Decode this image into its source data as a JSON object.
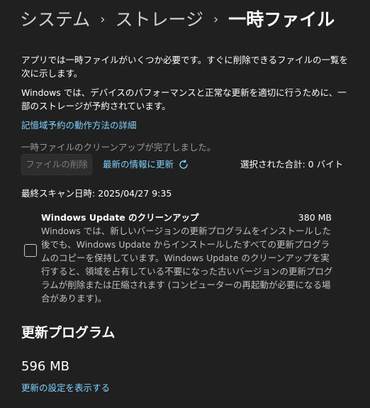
{
  "breadcrumb": {
    "items": [
      "システム",
      "ストレージ"
    ],
    "current": "一時ファイル"
  },
  "intro": "アプリでは一時ファイルがいくつか必要です。すぐに削除できるファイルの一覧を次に示します。",
  "reserve_note": "Windows では、デバイスのパフォーマンスと正常な更新を適切に行うために、一部のストレージが予約されています。",
  "reserve_link": "記憶域予約の動作方法の詳細",
  "cleanup_status": "一時ファイルのクリーンアップが完了しました。",
  "actions": {
    "delete_label": "ファイルの削除",
    "refresh_label": "最新の情報に更新",
    "selected_total": "選択された合計: 0 バイト"
  },
  "last_scan": "最終スキャン日時: 2025/04/27 9:35",
  "items": [
    {
      "title": "Windows Update のクリーンアップ",
      "size": "380 MB",
      "description": "Windows では、新しいバージョンの更新プログラムをインストールした後でも、Windows Update からインストールしたすべての更新プログラムのコピーを保持しています。Windows Update のクリーンアップを実行すると、領域を占有している不要になった古いバージョンの更新プログラムが削除または圧縮されます (コンピューターの再起動が必要になる場合があります)。",
      "checked": false
    }
  ],
  "updates_section": {
    "heading": "更新プログラム",
    "size": "596 MB",
    "link": "更新の設定を表示する"
  },
  "colors": {
    "background": "#202020",
    "link": "#7fd3ff",
    "muted": "#9a9a9a"
  }
}
